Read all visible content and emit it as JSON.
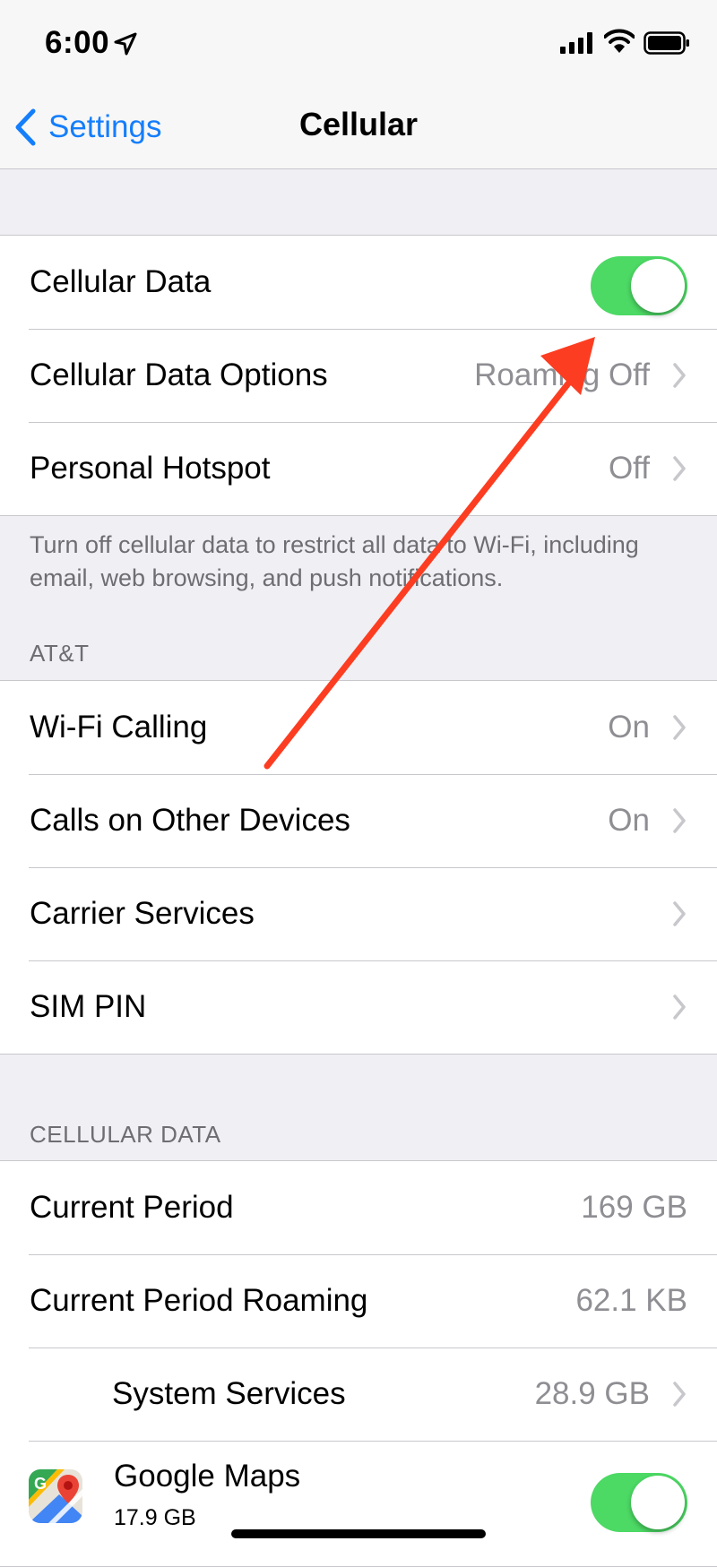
{
  "status_bar": {
    "time": "6:00"
  },
  "nav": {
    "back_label": "Settings",
    "title": "Cellular"
  },
  "group1": {
    "cellular_data_label": "Cellular Data",
    "cellular_data_options_label": "Cellular Data Options",
    "cellular_data_options_value": "Roaming Off",
    "personal_hotspot_label": "Personal Hotspot",
    "personal_hotspot_value": "Off"
  },
  "group1_footer": "Turn off cellular data to restrict all data to Wi-Fi, including email, web browsing, and push notifications.",
  "carrier_section": {
    "header": "AT&T",
    "wifi_calling_label": "Wi-Fi Calling",
    "wifi_calling_value": "On",
    "calls_other_label": "Calls on Other Devices",
    "calls_other_value": "On",
    "carrier_services_label": "Carrier Services",
    "sim_pin_label": "SIM PIN"
  },
  "usage_section": {
    "header": "CELLULAR DATA",
    "current_period_label": "Current Period",
    "current_period_value": "169 GB",
    "roaming_label": "Current Period Roaming",
    "roaming_value": "62.1 KB",
    "system_services_label": "System Services",
    "system_services_value": "28.9 GB",
    "google_maps_label": "Google Maps",
    "google_maps_usage": "17.9 GB"
  },
  "toggles": {
    "cellular_data_on": true,
    "google_maps_on": true
  },
  "colors": {
    "accent": "#147efb",
    "toggle_on": "#4cd964",
    "annotation_arrow": "#fc3d21"
  },
  "icons": [
    "location-arrow-icon",
    "signal-bars-icon",
    "wifi-icon",
    "battery-icon",
    "back-chevron-icon",
    "chevron-right-icon",
    "google-maps-icon",
    "annotation-arrow"
  ]
}
